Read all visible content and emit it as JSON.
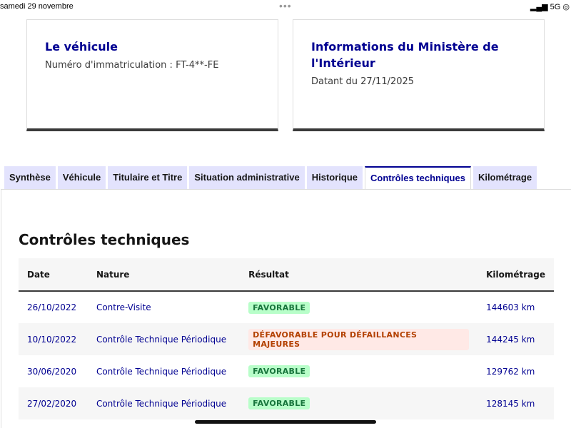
{
  "status_bar": {
    "date": "samedi 29 novembre",
    "network": "5G",
    "signal_icon": "signal-bars"
  },
  "cards": [
    {
      "title": "Le véhicule",
      "text": "Numéro d'immatriculation : FT-4**-FE"
    },
    {
      "title": "Informations du Ministère de l'Intérieur",
      "text": "Datant du 27/11/2025"
    }
  ],
  "tabs": [
    "Synthèse",
    "Véhicule",
    "Titulaire et Titre",
    "Situation administrative",
    "Historique",
    "Contrôles techniques",
    "Kilométrage"
  ],
  "active_tab": "Contrôles techniques",
  "section": {
    "title": "Contrôles techniques",
    "headers": [
      "Date",
      "Nature",
      "Résultat",
      "Kilométrage"
    ],
    "rows": [
      {
        "date": "26/10/2022",
        "nature": "Contre-Visite",
        "result": "FAVORABLE",
        "km": "144603 km"
      },
      {
        "date": "10/10/2022",
        "nature": "Contrôle Technique Périodique",
        "result": "DÉFAVORABLE POUR DÉFAILLANCES MAJEURES",
        "km": "144245 km"
      },
      {
        "date": "30/06/2020",
        "nature": "Contrôle Technique Périodique",
        "result": "FAVORABLE",
        "km": "129762 km"
      },
      {
        "date": "27/02/2020",
        "nature": "Contrôle Technique Périodique",
        "result": "FAVORABLE",
        "km": "128145 km"
      }
    ]
  },
  "colors": {
    "accent": "#000091",
    "ok": "#18753c",
    "ko": "#b34000"
  }
}
